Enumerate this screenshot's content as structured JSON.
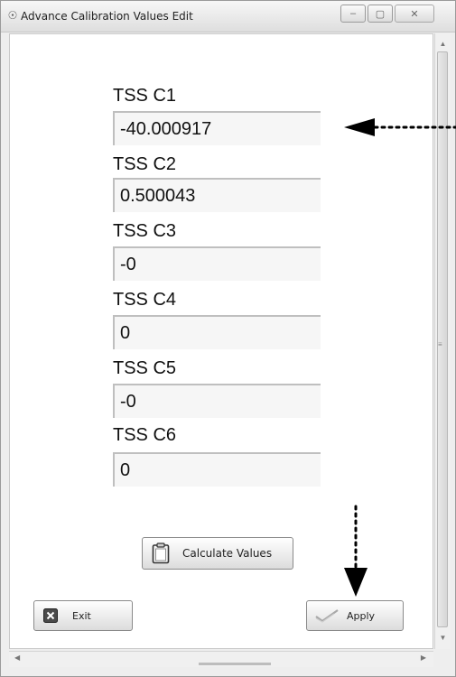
{
  "window": {
    "title": "Advance Calibration Values Edit",
    "app_icon": "app-icon",
    "min_glyph": "–",
    "max_glyph": "▢",
    "close_glyph": "✕"
  },
  "fields": [
    {
      "label": "TSS C1",
      "value": "-40.000917"
    },
    {
      "label": "TSS C2",
      "value": "0.500043"
    },
    {
      "label": "TSS C3",
      "value": "-0"
    },
    {
      "label": "TSS C4",
      "value": "0"
    },
    {
      "label": "TSS C5",
      "value": "-0"
    },
    {
      "label": "TSS C6",
      "value": "0"
    }
  ],
  "buttons": {
    "calculate_label": "Calculate Values",
    "exit_label": "Exit",
    "apply_label": "Apply"
  },
  "colors": {
    "input_bg": "#f6f6f6",
    "arrow": "#000000"
  }
}
